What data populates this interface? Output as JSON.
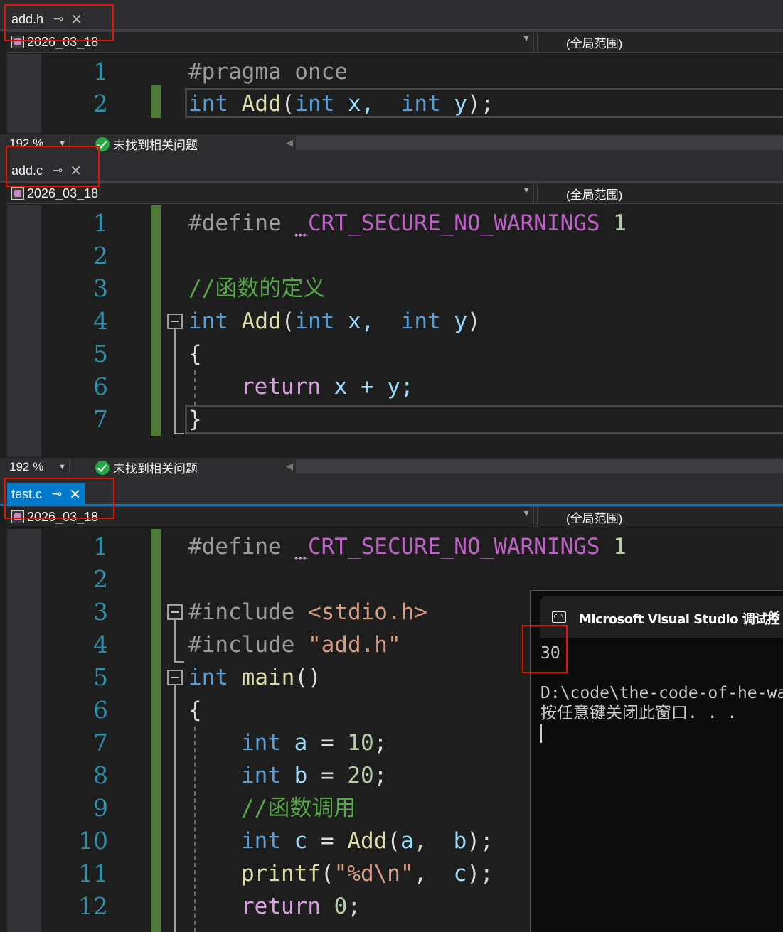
{
  "panes": [
    {
      "tab": {
        "label": "add.h",
        "pin": "⊸",
        "close": "✕"
      },
      "nav": {
        "project": "2026_03_18",
        "scope": "(全局范围)"
      },
      "lines": [
        "1",
        "2"
      ],
      "code": {
        "l1": {
          "pp": "#pragma",
          "rest": " once"
        },
        "l2": {
          "kw1": "int",
          "fn": " Add",
          "p1": "(",
          "kw2": "int",
          "v1": " x,",
          "kw3": "  int",
          "v2": " y",
          "end": ");"
        }
      }
    },
    {
      "tab": {
        "label": "add.c",
        "pin": "⊸",
        "close": "✕"
      },
      "nav": {
        "project": "2026_03_18",
        "scope": "(全局范围)"
      },
      "lines": [
        "1",
        "2",
        "3",
        "4",
        "5",
        "6",
        "7"
      ],
      "code": {
        "l1": {
          "pp": "#define",
          "mc": " _CRT_SECURE_NO_WARNINGS",
          "num": " 1"
        },
        "l3": {
          "cm": "//函数的定义"
        },
        "l4": {
          "kw1": "int",
          "fn": " Add",
          "p1": "(",
          "kw2": "int",
          "v1": " x,",
          "kw3": "  int",
          "v2": " y",
          "end": ")"
        },
        "l5": {
          "t": "{"
        },
        "l6": {
          "ctl": "return",
          "rest": " x + y;"
        },
        "l7": {
          "t": "}"
        }
      }
    },
    {
      "tab": {
        "label": "test.c",
        "pin": "⊸",
        "close": "✕"
      },
      "nav": {
        "project": "2026_03_18",
        "scope": "(全局范围)"
      },
      "lines": [
        "1",
        "2",
        "3",
        "4",
        "5",
        "6",
        "7",
        "8",
        "9",
        "10",
        "11",
        "12"
      ],
      "code": {
        "l1": {
          "pp": "#define",
          "mc": " _CRT_SECURE_NO_WARNINGS",
          "num": " 1"
        },
        "l3": {
          "pp": "#include",
          "str": " <stdio.h>"
        },
        "l4": {
          "pp": "#include",
          "str": " \"add.h\""
        },
        "l5": {
          "kw": "int",
          "fn": " main",
          "rest": "()"
        },
        "l6": {
          "t": "{"
        },
        "l7": {
          "kw": "int",
          "v": " a",
          "op": " = ",
          "num": "10",
          "end": ";"
        },
        "l8": {
          "kw": "int",
          "v": " b",
          "op": " = ",
          "num": "20",
          "end": ";"
        },
        "l9": {
          "cm": "//函数调用"
        },
        "l10": {
          "kw": "int",
          "v": " c",
          "op": " = ",
          "fn": "Add",
          "p1": "(",
          "a": "a",
          "comma": ",  ",
          "b": "b",
          "end": ");"
        },
        "l11": {
          "fn": "printf",
          "p1": "(",
          "str": "\"%d\\n\"",
          "comma": ",  ",
          "v": "c",
          "end": ");"
        },
        "l12": {
          "ctl": "return",
          "num": " 0",
          "end": ";"
        }
      }
    }
  ],
  "status": [
    {
      "zoom": "192 %",
      "issues": "未找到相关问题"
    },
    {
      "zoom": "192 %",
      "issues": "未找到相关问题"
    }
  ],
  "console": {
    "title": "Microsoft Visual Studio 调试控",
    "close": "✕",
    "icon": "C:\\",
    "output_value": "30",
    "path_line": "D:\\code\\the-code-of-he-wa",
    "prompt_line": "按任意键关闭此窗口. . ."
  },
  "colors": {
    "keyword": "#569cd6",
    "function": "#dcdcaa",
    "comment": "#57a64a",
    "line_number": "#2b91af",
    "accent": "#007acc",
    "highlight_box": "#e51400"
  }
}
